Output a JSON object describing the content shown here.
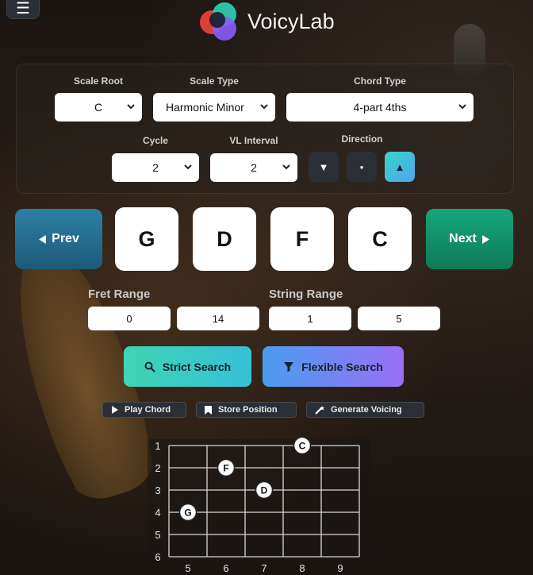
{
  "app": {
    "title": "VoicyLab"
  },
  "header": {
    "menu_icon": "hamburger-icon",
    "menu_glyph": "☰"
  },
  "controls": {
    "scale_root": {
      "label": "Scale Root",
      "value": "C"
    },
    "scale_type": {
      "label": "Scale Type",
      "value": "Harmonic Minor"
    },
    "chord_type": {
      "label": "Chord Type",
      "value": "4-part 4ths"
    },
    "cycle": {
      "label": "Cycle",
      "value": "2"
    },
    "vl_interval": {
      "label": "VL Interval",
      "value": "2"
    },
    "direction": {
      "label": "Direction",
      "buttons": [
        "▼",
        "•",
        "▲"
      ],
      "active_index": 2
    }
  },
  "navigation": {
    "prev_label": "Prev",
    "next_label": "Next"
  },
  "chord_notes": [
    "G",
    "D",
    "F",
    "C"
  ],
  "ranges": {
    "fret_range": {
      "label": "Fret Range",
      "min": "0",
      "max": "14"
    },
    "string_range": {
      "label": "String Range",
      "min": "1",
      "max": "5"
    }
  },
  "search": {
    "strict_label": "Strict Search",
    "flexible_label": "Flexible Search"
  },
  "actions": {
    "play_label": "Play Chord",
    "store_label": "Store Position",
    "generate_label": "Generate Voicing"
  },
  "fretboard": {
    "string_labels": [
      "1",
      "2",
      "3",
      "4",
      "5",
      "6"
    ],
    "fret_labels": [
      "5",
      "6",
      "7",
      "8",
      "9"
    ],
    "dots": [
      {
        "note": "C",
        "string": 1,
        "fret": 8
      },
      {
        "note": "F",
        "string": 2,
        "fret": 6
      },
      {
        "note": "D",
        "string": 3,
        "fret": 7
      },
      {
        "note": "G",
        "string": 4,
        "fret": 5
      }
    ]
  },
  "colors": {
    "prev": "#2f7fa6",
    "next": "#17a67a",
    "strict": "#3fd4b4",
    "flexible": "#9b6ff5",
    "direction_active": "#37d3c9"
  }
}
